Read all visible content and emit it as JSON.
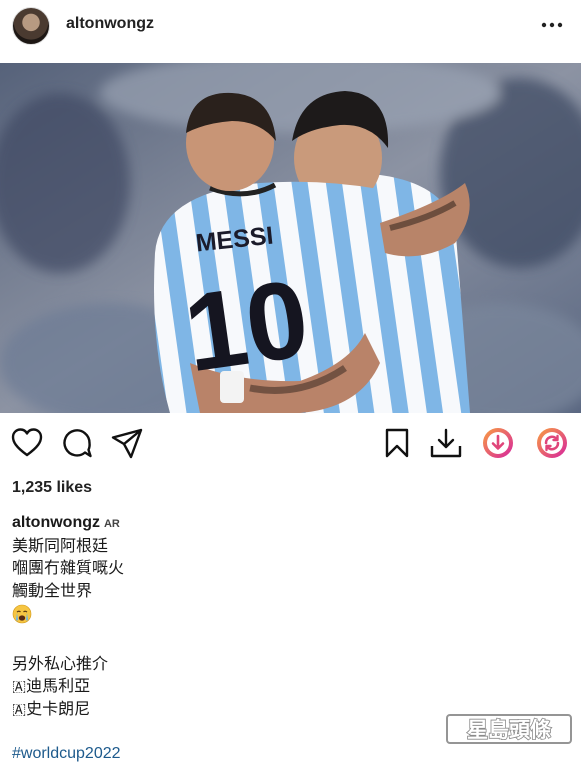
{
  "header": {
    "username": "altonwongz",
    "avatar_icon": "profile-photo",
    "more_icon": "more-horizontal-icon"
  },
  "photo": {
    "jersey_name": "MESSI",
    "jersey_number": "10"
  },
  "actions": {
    "icons": [
      "heart-icon",
      "comment-icon",
      "share-icon",
      "bookmark-icon",
      "download-icon",
      "download-circle-icon",
      "repost-icon"
    ]
  },
  "likes": "1,235 likes",
  "caption": {
    "username": "altonwongz",
    "tag": "AR",
    "lines": [
      "美斯同阿根廷",
      "嗰團冇雜質嘅火",
      "觸動全世界"
    ],
    "emoji": "😭",
    "lines2": [
      "另外私心推介",
      "🇦迪馬利亞",
      "🇦史卡朗尼"
    ],
    "hashtag": "#worldcup2022"
  },
  "watermark": {
    "text": "星島頭條"
  },
  "colors": {
    "jersey_blue": "#7fb6e6",
    "insta_gradient_start": "#f9a03f",
    "insta_gradient_end": "#d6249f",
    "hashtag": "#1d5a8c"
  }
}
